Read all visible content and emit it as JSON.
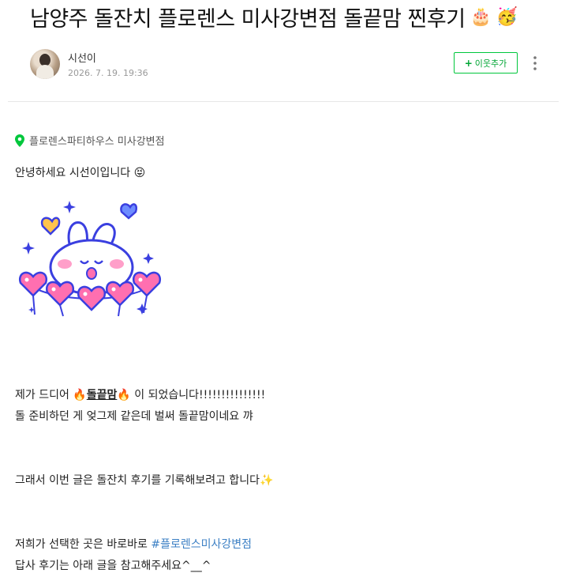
{
  "post": {
    "title": "남양주 돌잔치 플로렌스 미사강변점 돌끝맘 찐후기",
    "title_emojis": [
      "🎂",
      "🥳"
    ],
    "author": "시선이",
    "date": "2026. 7. 19. 19:36",
    "follow_label": "이웃추가",
    "follow_icon": "+",
    "place": "플로렌스파티하우스 미사강변점"
  },
  "body": {
    "greeting": "안녕하세요 시선이입니다",
    "greeting_emoji": "😝",
    "p1_prefix": "제가 드디어",
    "p1_fire": "🔥",
    "p1_bold": "돌끝맘",
    "p1_suffix": "이 되었습니다!!!!!!!!!!!!!!!",
    "p2": "돌 준비하던 게 엊그제 같은데 벌써 돌끝맘이네요 꺄",
    "p3": "그래서 이번 글은 돌잔치 후기를 기록해보려고 합니다",
    "p3_emoji": "✨",
    "p4_prefix": "저희가 선택한 곳은 바로바로",
    "p4_hashtag": "#플로렌스미사강변점",
    "p5": "답사 후기는 아래 글을 참고해주세요^__^"
  },
  "colors": {
    "accent_green": "#00c73c",
    "hashtag_blue": "#3b7fc4",
    "sticker_outline": "#3a3fe0",
    "heart_pink": "#ff6fb0"
  },
  "icons": {
    "place": "location-pin-icon",
    "more": "kebab-menu-icon"
  }
}
